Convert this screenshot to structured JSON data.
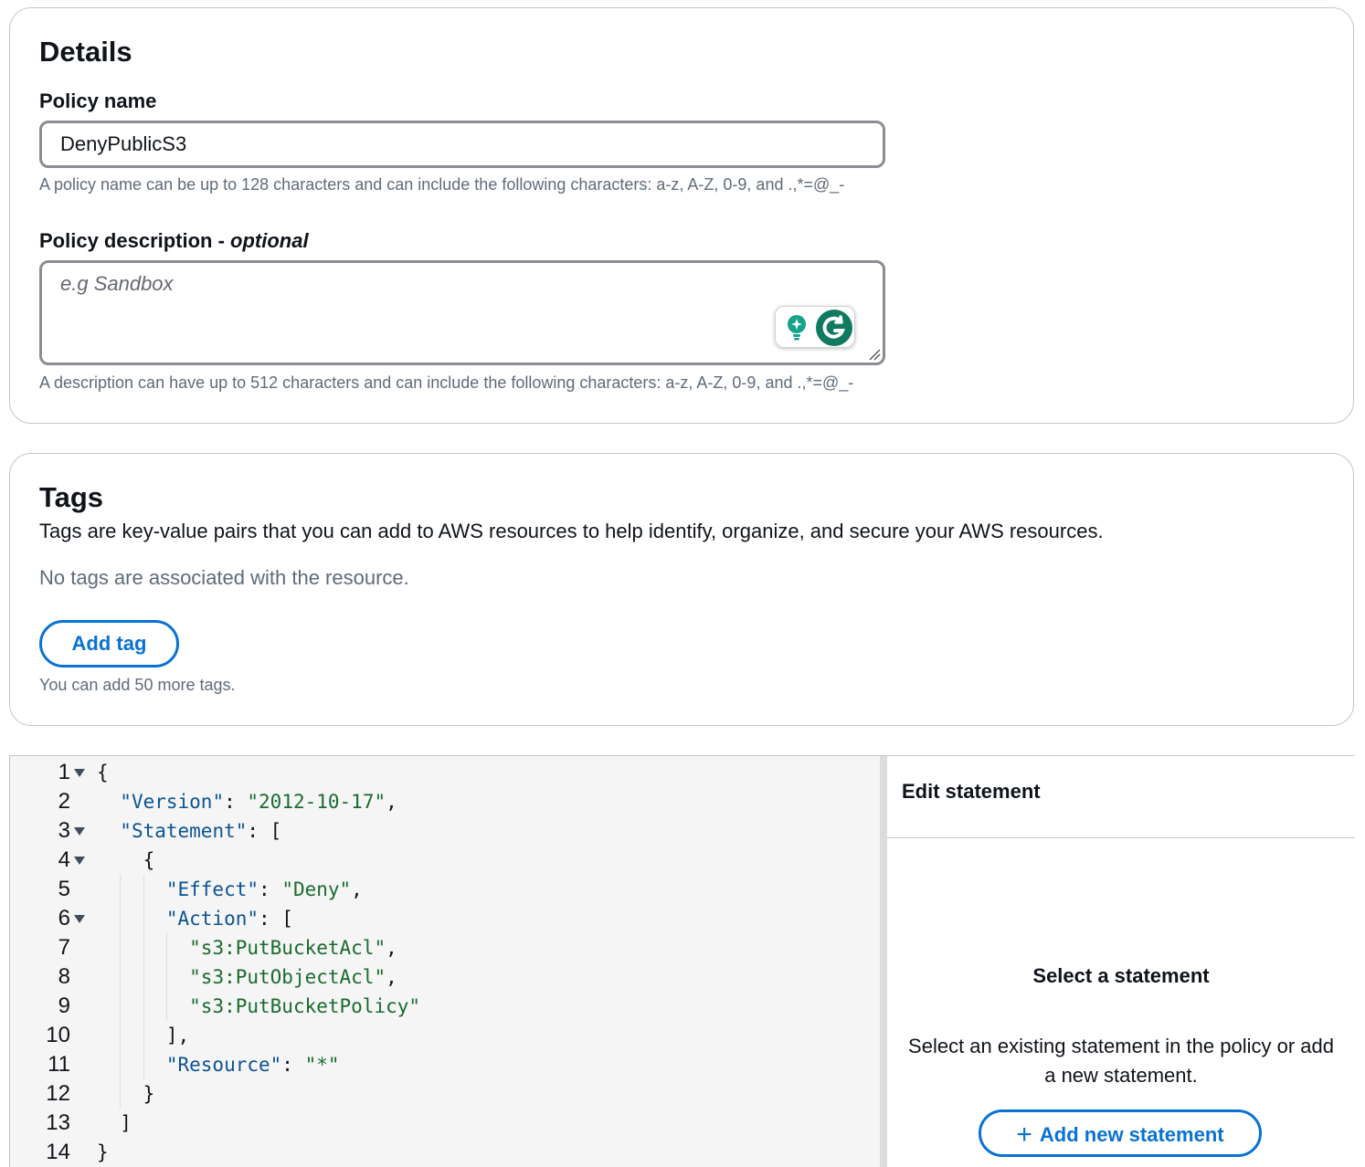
{
  "details": {
    "heading": "Details",
    "policy_name_label": "Policy name",
    "policy_name_value": "DenyPublicS3",
    "policy_name_hint": "A policy name can be up to 128 characters and can include the following characters: a-z, A-Z, 0-9, and .,*=@_-",
    "description_label": "Policy description - ",
    "description_label_optional": "optional",
    "description_placeholder": "e.g Sandbox",
    "description_hint": "A description can have up to 512 characters and can include the following characters: a-z, A-Z, 0-9, and .,*=@_-"
  },
  "tags": {
    "heading": "Tags",
    "description": "Tags are key-value pairs that you can add to AWS resources to help identify, organize, and secure your AWS resources.",
    "empty_text": "No tags are associated with the resource.",
    "add_button": "Add tag",
    "remaining_text": "You can add 50 more tags."
  },
  "editor": {
    "lines": [
      {
        "n": "1",
        "fold": true,
        "segments": [
          {
            "t": "{",
            "c": "p"
          }
        ]
      },
      {
        "n": "2",
        "fold": false,
        "segments": [
          {
            "t": "  ",
            "c": "p"
          },
          {
            "t": "\"Version\"",
            "c": "k"
          },
          {
            "t": ": ",
            "c": "p"
          },
          {
            "t": "\"2012-10-17\"",
            "c": "s"
          },
          {
            "t": ",",
            "c": "p"
          }
        ]
      },
      {
        "n": "3",
        "fold": true,
        "segments": [
          {
            "t": "  ",
            "c": "p"
          },
          {
            "t": "\"Statement\"",
            "c": "k"
          },
          {
            "t": ": [",
            "c": "p"
          }
        ]
      },
      {
        "n": "4",
        "fold": true,
        "segments": [
          {
            "t": "    {",
            "c": "p"
          }
        ]
      },
      {
        "n": "5",
        "fold": false,
        "segments": [
          {
            "t": "      ",
            "c": "p"
          },
          {
            "t": "\"Effect\"",
            "c": "k"
          },
          {
            "t": ": ",
            "c": "p"
          },
          {
            "t": "\"Deny\"",
            "c": "s"
          },
          {
            "t": ",",
            "c": "p"
          }
        ]
      },
      {
        "n": "6",
        "fold": true,
        "segments": [
          {
            "t": "      ",
            "c": "p"
          },
          {
            "t": "\"Action\"",
            "c": "k"
          },
          {
            "t": ": [",
            "c": "p"
          }
        ]
      },
      {
        "n": "7",
        "fold": false,
        "segments": [
          {
            "t": "        ",
            "c": "p"
          },
          {
            "t": "\"s3:PutBucketAcl\"",
            "c": "s"
          },
          {
            "t": ",",
            "c": "p"
          }
        ]
      },
      {
        "n": "8",
        "fold": false,
        "segments": [
          {
            "t": "        ",
            "c": "p"
          },
          {
            "t": "\"s3:PutObjectAcl\"",
            "c": "s"
          },
          {
            "t": ",",
            "c": "p"
          }
        ]
      },
      {
        "n": "9",
        "fold": false,
        "segments": [
          {
            "t": "        ",
            "c": "p"
          },
          {
            "t": "\"s3:PutBucketPolicy\"",
            "c": "s"
          }
        ]
      },
      {
        "n": "10",
        "fold": false,
        "segments": [
          {
            "t": "      ],",
            "c": "p"
          }
        ]
      },
      {
        "n": "11",
        "fold": false,
        "segments": [
          {
            "t": "      ",
            "c": "p"
          },
          {
            "t": "\"Resource\"",
            "c": "k"
          },
          {
            "t": ": ",
            "c": "p"
          },
          {
            "t": "\"*\"",
            "c": "s"
          }
        ]
      },
      {
        "n": "12",
        "fold": false,
        "segments": [
          {
            "t": "    }",
            "c": "p"
          }
        ]
      },
      {
        "n": "13",
        "fold": false,
        "segments": [
          {
            "t": "  ]",
            "c": "p"
          }
        ]
      },
      {
        "n": "14",
        "fold": false,
        "segments": [
          {
            "t": "}",
            "c": "p"
          }
        ]
      }
    ]
  },
  "side_panel": {
    "header": "Edit statement",
    "empty_title": "Select a statement",
    "empty_description": "Select an existing statement in the policy or add a new statement.",
    "add_button": "Add new statement"
  },
  "colors": {
    "accent": "#0972d3",
    "json_key": "#0b5394",
    "json_string": "#1a6b2f"
  }
}
